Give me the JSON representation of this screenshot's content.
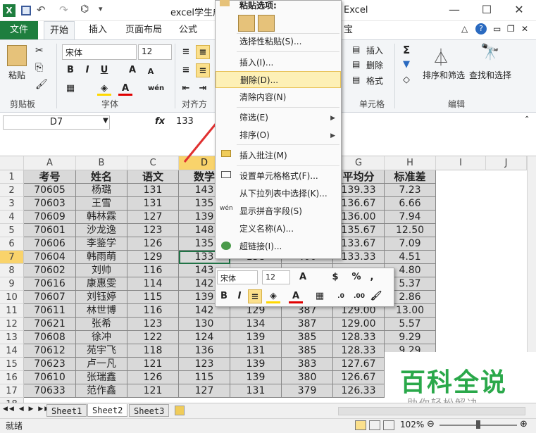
{
  "window": {
    "title_left": "excel学生成",
    "title_right": "Excel"
  },
  "tabs": {
    "file": "文件",
    "home": "开始",
    "insert": "插入",
    "layout": "页面布局",
    "formula": "公式",
    "partial": "宝"
  },
  "ribbon": {
    "paste": "粘贴",
    "font_name": "宋体",
    "font_size": "12",
    "bold": "B",
    "italic": "I",
    "underline": "U",
    "insert": "插入",
    "delete": "删除",
    "format": "格式",
    "sort_filter": "排序和筛选",
    "find_select": "查找和选择",
    "groups": {
      "clipboard": "剪贴板",
      "font": "字体",
      "align": "对齐方",
      "cells": "单元格",
      "edit": "编辑"
    }
  },
  "formula_bar": {
    "name_box": "D7",
    "fx": "fx",
    "value": "133"
  },
  "columns": [
    "A",
    "B",
    "C",
    "D",
    "E",
    "F",
    "G",
    "H",
    "I",
    "J"
  ],
  "rows": [
    "1",
    "2",
    "3",
    "4",
    "5",
    "6",
    "7",
    "8",
    "9",
    "10",
    "11",
    "12",
    "13",
    "14",
    "15",
    "16",
    "17",
    "18"
  ],
  "table": {
    "headers": [
      "考号",
      "姓名",
      "语文",
      "数学",
      "",
      "",
      "平均分",
      "标准差"
    ],
    "data": [
      [
        "70605",
        "杨璐",
        "131",
        "143",
        "",
        "",
        "139.33",
        "7.23"
      ],
      [
        "70603",
        "王雪",
        "131",
        "135",
        "",
        "",
        "136.67",
        "6.66"
      ],
      [
        "70609",
        "韩林霖",
        "127",
        "139",
        "",
        "",
        "136.00",
        "7.94"
      ],
      [
        "70601",
        "沙龙逸",
        "123",
        "148",
        "",
        "",
        "135.67",
        "12.50"
      ],
      [
        "70606",
        "李鉴学",
        "126",
        "135",
        "",
        "",
        "133.67",
        "7.09"
      ],
      [
        "70604",
        "韩雨萌",
        "129",
        "133",
        "138",
        "400",
        "133.33",
        "4.51"
      ],
      [
        "70602",
        "刘帅",
        "116",
        "143",
        "",
        "",
        "",
        "4.80"
      ],
      [
        "70616",
        "康惠雯",
        "114",
        "142",
        "",
        "",
        "",
        "5.37"
      ],
      [
        "70607",
        "刘钰婷",
        "115",
        "139",
        "",
        "",
        "",
        "2.86"
      ],
      [
        "70611",
        "林世博",
        "116",
        "142",
        "129",
        "387",
        "129.00",
        "13.00"
      ],
      [
        "70621",
        "张希",
        "123",
        "130",
        "134",
        "387",
        "129.00",
        "5.57"
      ],
      [
        "70608",
        "徐冲",
        "122",
        "124",
        "139",
        "385",
        "128.33",
        "9.29"
      ],
      [
        "70612",
        "苑宇飞",
        "118",
        "136",
        "131",
        "385",
        "128.33",
        "9.29"
      ],
      [
        "70623",
        "卢一凡",
        "121",
        "123",
        "139",
        "383",
        "127.67",
        ""
      ],
      [
        "70610",
        "张瑞鑫",
        "126",
        "115",
        "139",
        "380",
        "126.67",
        ""
      ],
      [
        "70633",
        "范作鑫",
        "121",
        "127",
        "131",
        "379",
        "126.33",
        ""
      ]
    ]
  },
  "context_menu": {
    "header": "粘贴选项:",
    "items": [
      {
        "label": "选择性粘贴(S)..."
      },
      {
        "label": "插入(I)..."
      },
      {
        "label": "删除(D)..."
      },
      {
        "label": "清除内容(N)"
      },
      {
        "label": "筛选(E)"
      },
      {
        "label": "排序(O)"
      },
      {
        "label": "插入批注(M)"
      },
      {
        "label": "设置单元格格式(F)..."
      },
      {
        "label": "从下拉列表中选择(K)..."
      },
      {
        "label": "显示拼音字段(S)"
      },
      {
        "label": "定义名称(A)..."
      },
      {
        "label": "超链接(I)..."
      }
    ]
  },
  "mini_toolbar": {
    "font": "宋体",
    "size": "12",
    "percent": "%",
    "comma": ","
  },
  "sheets": [
    "Sheet1",
    "Sheet2",
    "Sheet3"
  ],
  "status": {
    "ready": "就绪",
    "zoom": "102%"
  },
  "watermark": {
    "title": "百科全说",
    "subtitle": "助你轻松解决"
  },
  "colors": {
    "excel_green": "#1e7e3e",
    "selection": "#f9d36b",
    "highlight": "#fdf0b6",
    "arrow": "#e03030"
  }
}
